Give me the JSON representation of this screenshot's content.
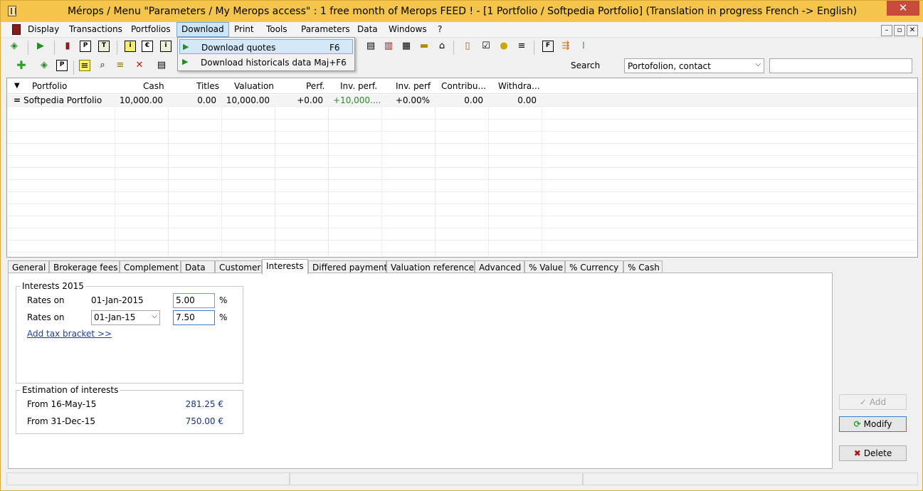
{
  "window": {
    "title": "Mérops / Menu \"Parameters / My Merops access\" : 1 free month of Merops FEED ! - [1 Portfolio / Softpedia Portfolio] (Translation in progress French -> English)",
    "close": "✕"
  },
  "menu": [
    "Display",
    "Transactions",
    "Portfolios",
    "Download",
    "Print",
    "Tools",
    "Parameters",
    "Data",
    "Windows",
    "?"
  ],
  "mdi": [
    "–",
    "▫",
    "✕"
  ],
  "download_menu": [
    {
      "label": "Download quotes",
      "shortcut": "F6",
      "icon": "download-quotes-icon"
    },
    {
      "label": "Download historicals data",
      "shortcut": "Maj+F6",
      "icon": "download-historicals-icon"
    }
  ],
  "toolbar": {
    "square_icons": [
      "P",
      "T",
      "i",
      "€",
      "i",
      "P"
    ]
  },
  "search": {
    "label": "Search",
    "selected": "Portofolion, contact",
    "value": ""
  },
  "grid": {
    "columns": [
      "Portfolio",
      "Cash",
      "Titles",
      "Valuation",
      "Perf.",
      "Inv. perf.",
      "Inv. perf",
      "Contribu...",
      "Withdra..."
    ],
    "rows": [
      {
        "marker": "=",
        "portfolio": "Softpedia Portfolio",
        "cash": "10,000.00",
        "titles": "0.00",
        "valuation": "10,000.00",
        "perf": "+0.00",
        "inv_perf": "+10,000....",
        "inv_perf_pct": "+0.00%",
        "contrib": "0.00",
        "withdraw": "0.00"
      }
    ]
  },
  "tabs": [
    "General",
    "Brokerage fees",
    "Complement",
    "Data",
    "Customer",
    "Interests",
    "Differed payment",
    "Valuation reference",
    "Advanced",
    "% Value",
    "% Currency",
    "% Cash"
  ],
  "interests": {
    "group_title": "Interests 2015",
    "rate1_label": "Rates on",
    "rate1_date": "01-Jan-2015",
    "rate1_value": "5.00",
    "unit": "%",
    "rate2_label": "Rates on",
    "rate2_date": "01-Jan-15",
    "rate2_value": "7.50",
    "add_link": "Add tax bracket >>"
  },
  "estimation": {
    "group_title": "Estimation of interests",
    "row1_label": "From 16-May-15",
    "row1_value": "281.25 €",
    "row2_label": "From 31-Dec-15",
    "row2_value": "750.00 €"
  },
  "buttons": {
    "add": "Add",
    "modify": "Modify",
    "delete": "Delete"
  },
  "colors": {
    "titlebar": "#f5c44a",
    "positive": "#2a8a2a",
    "link": "#1a3fa6",
    "value": "#1a2f82"
  }
}
